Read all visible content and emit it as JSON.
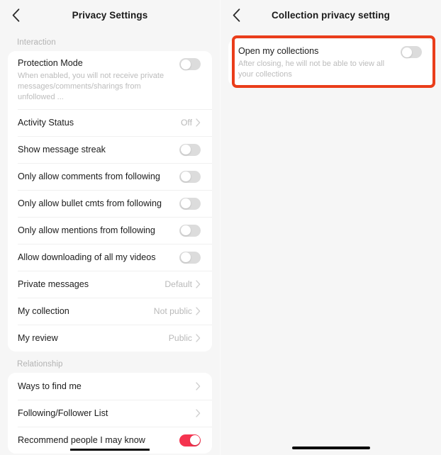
{
  "colors": {
    "accent_red": "#f5334f",
    "annotation_red": "#ea3d1a",
    "background": "#f6f6f6",
    "card": "#ffffff",
    "label_gray": "#b3b3b3"
  },
  "left_screen": {
    "nav": {
      "back_icon": "chevron-left-icon",
      "title": "Privacy Settings"
    },
    "groups": [
      {
        "label": "Interaction",
        "rows": [
          {
            "title": "Protection Mode",
            "desc": "When enabled, you will not receive private messages/comments/sharings from unfollowed ...",
            "control": "toggle",
            "toggle_on": false
          },
          {
            "title": "Activity Status",
            "value": "Off",
            "control": "chevron"
          },
          {
            "title": "Show message streak",
            "control": "toggle",
            "toggle_on": false
          },
          {
            "title": "Only allow comments from following",
            "control": "toggle",
            "toggle_on": false
          },
          {
            "title": "Only allow bullet cmts from following",
            "control": "toggle",
            "toggle_on": false
          },
          {
            "title": "Only allow mentions from following",
            "control": "toggle",
            "toggle_on": false
          },
          {
            "title": "Allow downloading of all my videos",
            "control": "toggle",
            "toggle_on": false
          },
          {
            "title": "Private messages",
            "value": "Default",
            "control": "chevron"
          },
          {
            "title": "My collection",
            "value": "Not public",
            "control": "chevron"
          },
          {
            "title": "My review",
            "value": "Public",
            "control": "chevron"
          }
        ]
      },
      {
        "label": "Relationship",
        "rows": [
          {
            "title": "Ways to find me",
            "value": "",
            "control": "chevron"
          },
          {
            "title": "Following/Follower List",
            "value": "",
            "control": "chevron"
          },
          {
            "title": "Recommend people I may know",
            "control": "toggle",
            "toggle_on": true
          }
        ]
      }
    ]
  },
  "right_screen": {
    "nav": {
      "back_icon": "chevron-left-icon",
      "title": "Collection privacy setting"
    },
    "rows": [
      {
        "title": "Open my collections",
        "desc": "After closing, he will not be able to view all your collections",
        "control": "toggle",
        "toggle_on": false
      }
    ],
    "annotation": {
      "type": "highlight-rectangle",
      "color": "#ea3d1a"
    },
    "home_indicator": true
  }
}
